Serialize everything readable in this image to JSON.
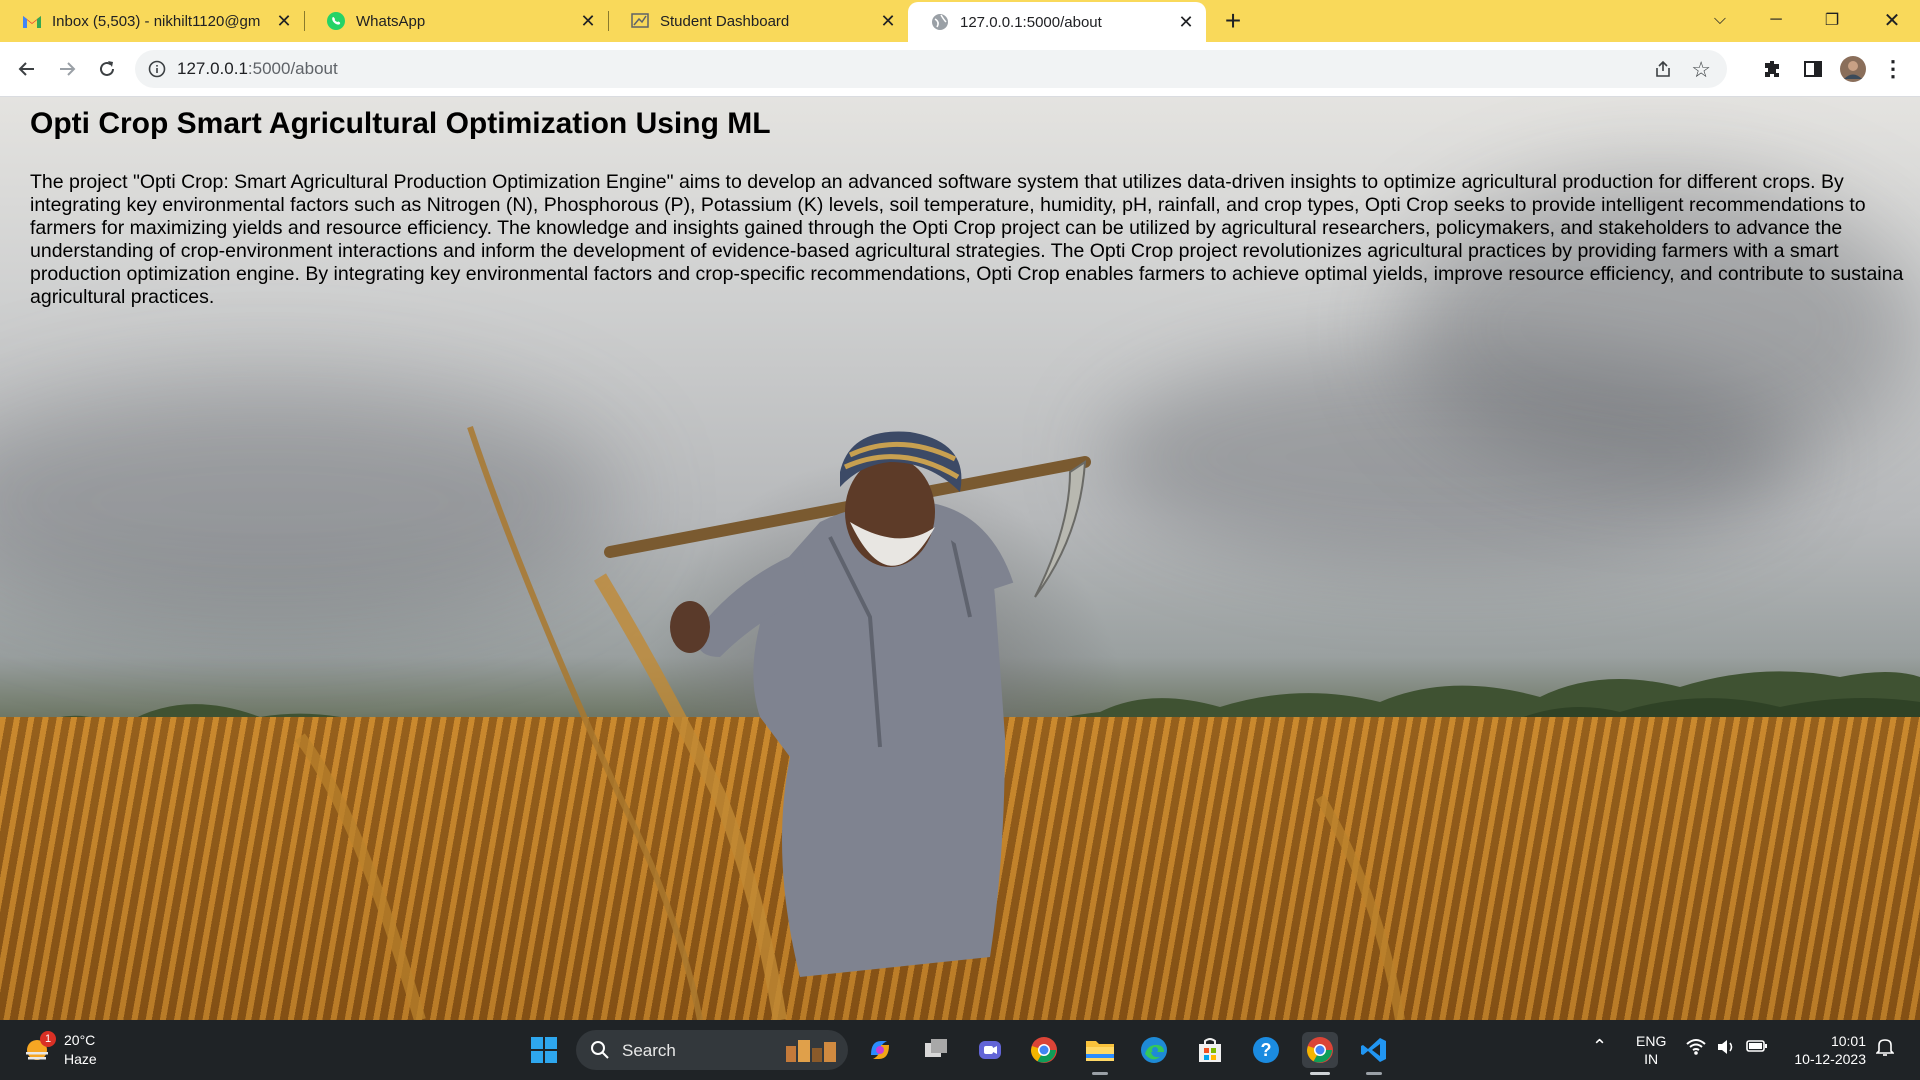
{
  "browser": {
    "tabs": [
      {
        "title": "Inbox (5,503) - nikhilt1120@gm",
        "icon": "gmail-icon"
      },
      {
        "title": "WhatsApp",
        "icon": "whatsapp-icon"
      },
      {
        "title": "Student Dashboard",
        "icon": "dashboard-icon"
      },
      {
        "title": "127.0.0.1:5000/about",
        "icon": "globe-icon",
        "active": true
      }
    ],
    "address": {
      "host": "127.0.0.1",
      "path": ":5000/about"
    }
  },
  "page": {
    "heading": "Opti Crop Smart Agricultural Optimization Using ML",
    "paragraph": "The project \"Opti Crop: Smart Agricultural Production Optimization Engine\" aims to develop an advanced software system that utilizes data-driven insights to optimize agricultural production for different crops. By integrating key environmental factors such as Nitrogen (N), Phosphorous (P), Potassium (K) levels, soil temperature, humidity, pH, rainfall, and crop types, Opti Crop seeks to provide intelligent recommendations to farmers for maximizing yields and resource efficiency. The knowledge and insights gained through the Opti Crop project can be utilized by agricultural researchers, policymakers, and stakeholders to advance the understanding of crop-environment interactions and inform the development of evidence-based agricultural strategies. The Opti Crop project revolutionizes agricultural practices by providing farmers with a smart production optimization engine. By integrating key environmental factors and crop-specific recommendations, Opti Crop enables farmers to achieve optimal yields, improve resource efficiency, and contribute to sustaina agricultural practices.",
    "background": "farmer-in-wheat-field-photo"
  },
  "taskbar": {
    "weather": {
      "temp": "20°C",
      "condition": "Haze",
      "badge": "1"
    },
    "search_label": "Search",
    "language": {
      "line1": "ENG",
      "line2": "IN"
    },
    "clock": {
      "time": "10:01",
      "date": "10-12-2023"
    }
  },
  "colors": {
    "tabstrip": "#f9d95a",
    "taskbar": "#1f2326",
    "omnibox": "#f1f3f4"
  }
}
